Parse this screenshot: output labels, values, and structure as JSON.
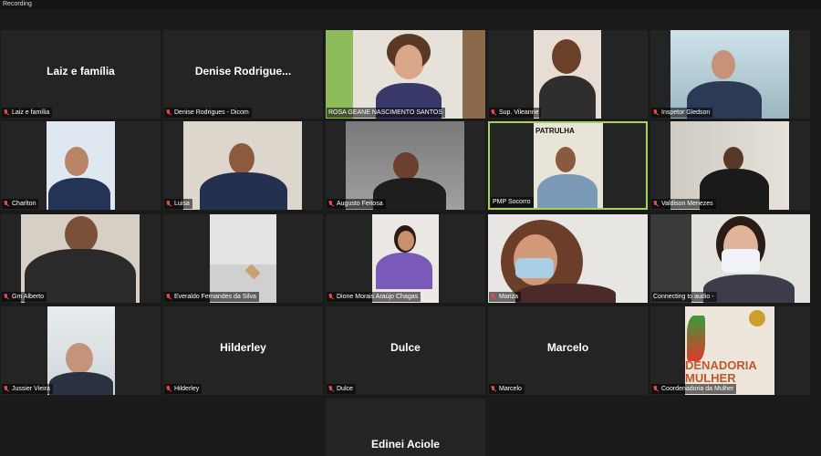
{
  "recording_label": "Recording",
  "participants": [
    {
      "name_label": "Laiz e família",
      "big_name": "Laiz e família"
    },
    {
      "name_label": "Denise Rodrigues - Dicom",
      "big_name": "Denise  Rodrigue..."
    },
    {
      "name_label": "ROSA GEANE NASCIMENTO SANTOS"
    },
    {
      "name_label": "Sup. Vileanne"
    },
    {
      "name_label": "Inspetor Gledson"
    },
    {
      "name_label": "Charlton"
    },
    {
      "name_label": "Luisa"
    },
    {
      "name_label": "Augusto Feitosa"
    },
    {
      "name_label": "PMP Socorro",
      "sign_text": "PATRULHA"
    },
    {
      "name_label": "Valdison Menezes"
    },
    {
      "name_label": "Gm Alberto"
    },
    {
      "name_label": "Everaldo Fernandes da Silva"
    },
    {
      "name_label": "Dione Morais Araújo Chagas"
    },
    {
      "name_label": "Mariza"
    },
    {
      "name_label": "Connecting to audio -"
    },
    {
      "name_label": "Jussier Vieira"
    },
    {
      "name_label": "Hilderley",
      "big_name": "Hilderley"
    },
    {
      "name_label": "Dulce",
      "big_name": "Dulce"
    },
    {
      "name_label": "Marcelo",
      "big_name": "Marcelo"
    },
    {
      "name_label": "Coordenadoria da Mulher",
      "poster_text": "DENADORIA MULHER"
    },
    {
      "big_name": "Edinei Aciole"
    }
  ],
  "colors": {
    "active_speaker_border": "#a8d35a",
    "muted_icon": "#e34b4b",
    "background": "#1a1a1a",
    "tile": "#242424"
  }
}
